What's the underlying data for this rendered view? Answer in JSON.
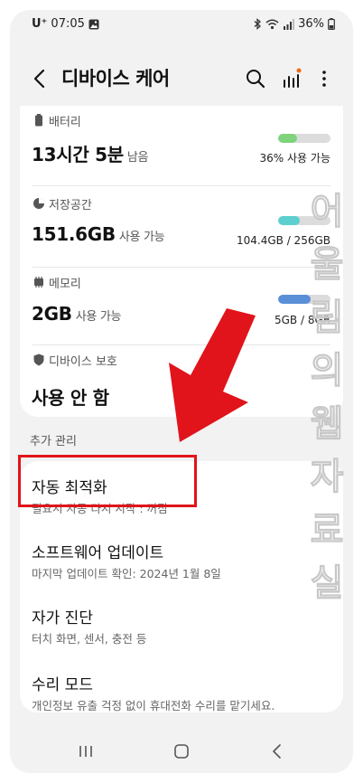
{
  "status_bar": {
    "carrier": "U⁺",
    "time": "07:05",
    "battery": "36%"
  },
  "app_bar": {
    "title": "디바이스 케어"
  },
  "battery": {
    "label": "배터리",
    "value": "13시간 5분",
    "value_suffix": "남음",
    "meta": "36% 사용 가능",
    "level": 0.36,
    "color": "#7ed37b"
  },
  "storage": {
    "label": "저장공간",
    "value": "151.6GB",
    "value_suffix": "사용 가능",
    "meta": "104.4GB / 256GB",
    "level": 0.41,
    "color": "#5ccfcf"
  },
  "memory": {
    "label": "메모리",
    "value": "2GB",
    "value_suffix": "사용 가능",
    "meta": "5GB / 8GB",
    "level": 0.62,
    "color": "#5a8fd8"
  },
  "protection": {
    "label": "디바이스 보호",
    "value": "사용 안 함"
  },
  "section_extra": "추가 관리",
  "items": [
    {
      "title": "자동 최적화",
      "subtitle": "필요시 자동 다시 시작 : 꺼짐"
    },
    {
      "title": "소프트웨어 업데이트",
      "subtitle": "마지막 업데이트 확인: 2024년 1월 8일"
    },
    {
      "title": "자가 진단",
      "subtitle": "터치 화면, 센서, 충전 등"
    },
    {
      "title": "수리 모드",
      "subtitle": "개인정보 유출 걱정 없이 휴대전화 수리를 맡기세요."
    }
  ],
  "watermark": "어울림의 웹자료실",
  "colors": {
    "highlight": "#e0141a",
    "background": "#f2f2f2"
  }
}
